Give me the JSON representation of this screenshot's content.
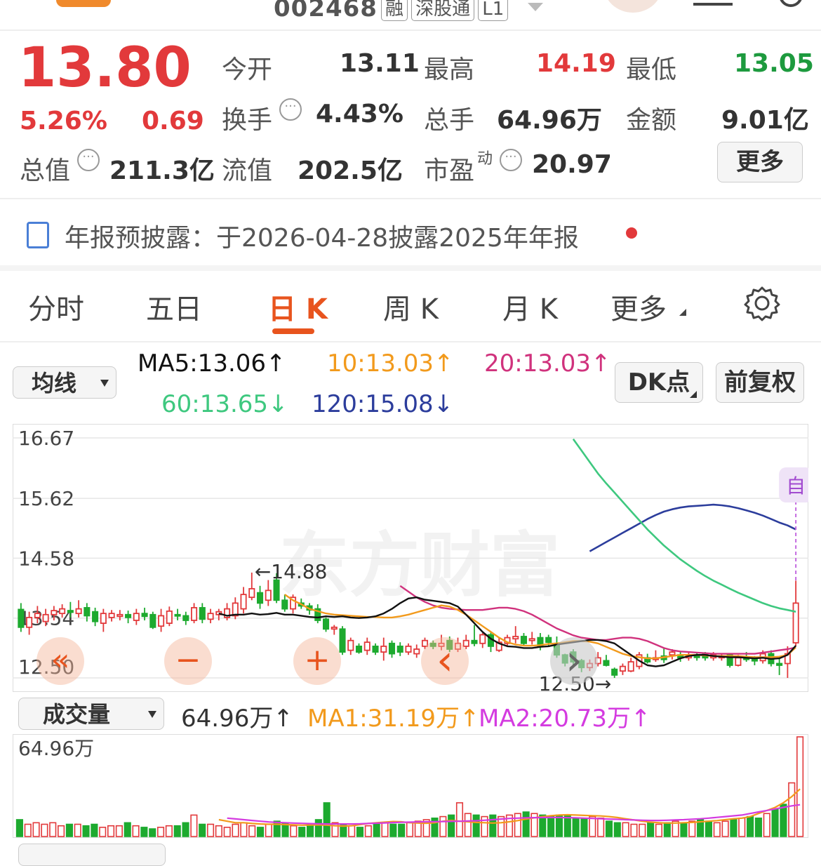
{
  "header": {
    "code": "002468",
    "tags": [
      "融",
      "深股通",
      "L1"
    ]
  },
  "quote": {
    "price": "13.80",
    "change_pct": "5.26%",
    "change_amt": "0.69",
    "items": [
      {
        "label": "今开",
        "value": "13.11"
      },
      {
        "label": "最高",
        "value": "14.19"
      },
      {
        "label": "最低",
        "value": "13.05"
      },
      {
        "label": "换手",
        "value": "4.43%"
      },
      {
        "label": "总手",
        "value": "64.96万"
      },
      {
        "label": "金额",
        "value": "9.01亿"
      },
      {
        "label": "总值",
        "value": "211.3亿"
      },
      {
        "label": "流值",
        "value": "202.5亿"
      },
      {
        "label": "市盈",
        "sup": "动",
        "value": "20.97"
      }
    ],
    "more_label": "更多"
  },
  "notice": {
    "text": "年报预披露：于2026-04-28披露2025年年报"
  },
  "tabs": [
    {
      "label": "分时"
    },
    {
      "label": "五日"
    },
    {
      "label": "日 K",
      "active": true
    },
    {
      "label": "周 K"
    },
    {
      "label": "月 K"
    },
    {
      "label": "更多"
    }
  ],
  "ma_bar": {
    "selector": "均线",
    "ma5": "MA5:13.06",
    "ma10": "10:13.03",
    "ma20": "20:13.03",
    "ma60": "60:13.65",
    "ma120": "120:15.08",
    "dk_label": "DK点",
    "fq_label": "前复权"
  },
  "colors": {
    "up": "#e2393b",
    "down": "#1daa2f",
    "ma5": "#111111",
    "ma10": "#f29a1c",
    "ma20": "#d0327d",
    "ma60": "#3ec87f",
    "ma120": "#2c3d9c",
    "accent": "#e8541e"
  },
  "chart_data": {
    "type": "candlestick",
    "y_ticks": [
      "16.67",
      "15.62",
      "14.58",
      "13.54",
      "12.50"
    ],
    "ylim": [
      12.5,
      16.67
    ],
    "high_annotation": "←14.88",
    "low_annotation": "12.50→",
    "marker_label": "自",
    "watermark": "东方财富",
    "candles": [
      [
        13.69,
        13.38,
        13.8,
        13.3
      ],
      [
        13.38,
        13.55,
        13.65,
        13.25
      ],
      [
        13.55,
        13.62,
        13.75,
        13.45
      ],
      [
        13.48,
        13.6,
        13.7,
        13.4
      ],
      [
        13.6,
        13.67,
        13.75,
        13.5
      ],
      [
        13.62,
        13.7,
        13.78,
        13.55
      ],
      [
        13.67,
        13.64,
        13.82,
        13.55
      ],
      [
        13.62,
        13.7,
        13.85,
        13.55
      ],
      [
        13.72,
        13.58,
        13.8,
        13.48
      ],
      [
        13.65,
        13.48,
        13.72,
        13.4
      ],
      [
        13.45,
        13.62,
        13.7,
        13.3
      ],
      [
        13.55,
        13.62,
        13.68,
        13.48
      ],
      [
        13.57,
        13.6,
        13.68,
        13.5
      ],
      [
        13.6,
        13.55,
        13.67,
        13.45
      ],
      [
        13.5,
        13.62,
        13.7,
        13.42
      ],
      [
        13.62,
        13.57,
        13.72,
        13.5
      ],
      [
        13.6,
        13.38,
        13.65,
        13.35
      ],
      [
        13.4,
        13.58,
        13.7,
        13.3
      ],
      [
        13.45,
        13.66,
        13.74,
        13.4
      ],
      [
        13.6,
        13.58,
        13.7,
        13.5
      ],
      [
        13.58,
        13.5,
        13.65,
        13.42
      ],
      [
        13.5,
        13.72,
        13.8,
        13.45
      ],
      [
        13.72,
        13.52,
        13.8,
        13.45
      ],
      [
        13.52,
        13.62,
        13.7,
        13.45
      ],
      [
        13.6,
        13.65,
        13.7,
        13.5
      ],
      [
        13.55,
        13.7,
        13.8,
        13.5
      ],
      [
        13.58,
        13.8,
        13.9,
        13.52
      ],
      [
        13.7,
        13.95,
        14.08,
        13.62
      ],
      [
        13.9,
        14.05,
        14.33,
        13.85
      ],
      [
        13.98,
        13.8,
        14.1,
        13.7
      ],
      [
        13.85,
        14.02,
        14.2,
        13.75
      ],
      [
        14.2,
        13.85,
        14.32,
        13.8
      ],
      [
        13.85,
        13.7,
        13.95,
        13.65
      ],
      [
        13.7,
        13.9,
        13.95,
        13.62
      ],
      [
        13.8,
        13.75,
        13.88,
        13.7
      ],
      [
        13.75,
        13.68,
        13.8,
        13.6
      ],
      [
        13.7,
        13.5,
        13.78,
        13.45
      ],
      [
        13.52,
        13.35,
        13.55,
        13.3
      ],
      [
        13.35,
        13.38,
        13.42,
        13.25
      ],
      [
        13.35,
        12.95,
        13.4,
        12.9
      ],
      [
        12.98,
        13.15,
        13.2,
        12.9
      ],
      [
        13.05,
        12.95,
        13.1,
        12.92
      ],
      [
        12.98,
        13.12,
        13.2,
        12.9
      ],
      [
        13.05,
        12.95,
        13.1,
        12.9
      ],
      [
        12.95,
        13.05,
        13.2,
        12.8
      ],
      [
        13.1,
        12.92,
        13.15,
        12.85
      ],
      [
        13.05,
        12.95,
        13.12,
        12.88
      ],
      [
        12.95,
        13.05,
        13.1,
        12.9
      ],
      [
        12.92,
        13.0,
        13.08,
        12.85
      ],
      [
        13.05,
        13.15,
        13.2,
        13.0
      ],
      [
        13.1,
        13.05,
        13.15,
        13.0
      ],
      [
        13.05,
        13.1,
        13.25,
        12.98
      ],
      [
        13.15,
        13.0,
        13.22,
        12.95
      ],
      [
        13.0,
        13.1,
        13.2,
        12.95
      ],
      [
        13.05,
        13.15,
        13.25,
        13.0
      ],
      [
        13.15,
        13.1,
        13.42,
        13.05
      ],
      [
        13.1,
        13.25,
        13.28,
        13.02
      ],
      [
        13.25,
        13.05,
        13.3,
        12.95
      ],
      [
        12.98,
        13.12,
        13.2,
        12.95
      ],
      [
        13.1,
        13.2,
        13.25,
        13.05
      ],
      [
        13.18,
        13.22,
        13.4,
        13.1
      ],
      [
        13.22,
        13.1,
        13.28,
        13.05
      ],
      [
        13.15,
        13.18,
        13.3,
        13.08
      ],
      [
        13.2,
        13.05,
        13.28,
        12.98
      ],
      [
        13.2,
        13.12,
        13.25,
        13.05
      ],
      [
        13.1,
        12.9,
        13.22,
        12.85
      ],
      [
        12.9,
        12.76,
        12.92,
        12.7
      ],
      [
        12.95,
        12.78,
        13.0,
        12.7
      ],
      [
        12.8,
        12.68,
        12.83,
        12.6
      ],
      [
        12.68,
        12.75,
        12.82,
        12.62
      ],
      [
        12.75,
        12.85,
        12.95,
        12.7
      ],
      [
        12.8,
        12.72,
        12.9,
        12.7
      ],
      [
        12.65,
        12.55,
        12.68,
        12.5
      ],
      [
        12.62,
        12.7,
        12.75,
        12.55
      ],
      [
        12.62,
        12.78,
        12.85,
        12.6
      ],
      [
        12.7,
        12.9,
        12.95,
        12.65
      ],
      [
        12.85,
        12.78,
        12.92,
        12.75
      ],
      [
        12.82,
        12.85,
        12.98,
        12.78
      ],
      [
        12.88,
        12.82,
        13.02,
        12.76
      ],
      [
        12.9,
        12.95,
        13.0,
        12.82
      ],
      [
        12.9,
        12.85,
        12.95,
        12.78
      ],
      [
        12.85,
        12.9,
        12.95,
        12.8
      ],
      [
        12.88,
        12.86,
        12.93,
        12.8
      ],
      [
        12.92,
        12.85,
        12.95,
        12.8
      ],
      [
        12.85,
        12.9,
        12.95,
        12.8
      ],
      [
        12.85,
        12.88,
        12.92,
        12.8
      ],
      [
        12.9,
        12.72,
        12.93,
        12.68
      ],
      [
        12.72,
        12.85,
        12.9,
        12.7
      ],
      [
        12.85,
        12.82,
        12.95,
        12.78
      ],
      [
        12.82,
        12.8,
        12.88,
        12.72
      ],
      [
        12.8,
        12.92,
        12.98,
        12.75
      ],
      [
        12.92,
        12.75,
        12.98,
        12.7
      ],
      [
        12.75,
        12.72,
        12.85,
        12.55
      ],
      [
        12.75,
        12.92,
        13.05,
        12.5
      ],
      [
        13.11,
        13.8,
        14.19,
        13.05
      ]
    ],
    "ma5": [
      13.62,
      13.58,
      13.6,
      13.6,
      13.62,
      13.6,
      13.61,
      13.63,
      13.6,
      13.6,
      13.58,
      13.56,
      13.55,
      13.57,
      13.56,
      13.57,
      13.55,
      13.54,
      13.55,
      13.57,
      13.62,
      13.7,
      13.8,
      13.88,
      13.9,
      13.86,
      13.84,
      13.82,
      13.8,
      13.74,
      13.6,
      13.45,
      13.3,
      13.18,
      13.1,
      13.05,
      13.04,
      13.02,
      13.02,
      13.04,
      13.05,
      13.08,
      13.1,
      13.12,
      13.14,
      13.16,
      13.16,
      13.14,
      13.1,
      13.0,
      12.9,
      12.8,
      12.72,
      12.7,
      12.72,
      12.78,
      12.84,
      12.88,
      12.9,
      12.9,
      12.88,
      12.87,
      12.86,
      12.86,
      12.85,
      12.84,
      12.85,
      12.83,
      12.84,
      12.9,
      13.06
    ],
    "ma10": [
      13.95,
      13.85,
      13.78,
      13.7,
      13.66,
      13.62,
      13.6,
      13.59,
      13.58,
      13.57,
      13.56,
      13.56,
      13.55,
      13.55,
      13.57,
      13.6,
      13.64,
      13.68,
      13.72,
      13.76,
      13.74,
      13.68,
      13.6,
      13.5,
      13.4,
      13.3,
      13.2,
      13.12,
      13.08,
      13.06,
      13.06,
      13.07,
      13.09,
      13.1,
      13.12,
      13.14,
      13.14,
      13.13,
      13.1,
      13.04,
      12.98,
      12.92,
      12.88,
      12.86,
      12.84,
      12.84,
      12.86,
      12.88,
      12.9,
      12.9,
      12.9,
      12.89,
      12.88,
      12.88,
      12.88,
      12.88,
      12.87,
      12.86,
      12.86,
      12.86,
      12.87,
      12.9,
      13.03
    ],
    "ma20": [
      14.1,
      14.0,
      13.9,
      13.82,
      13.76,
      13.72,
      13.7,
      13.69,
      13.68,
      13.68,
      13.68,
      13.7,
      13.72,
      13.72,
      13.7,
      13.66,
      13.6,
      13.52,
      13.44,
      13.36,
      13.3,
      13.24,
      13.2,
      13.18,
      13.16,
      13.16,
      13.18,
      13.2,
      13.2,
      13.18,
      13.14,
      13.08,
      13.02,
      12.98,
      12.96,
      12.95,
      12.94,
      12.93,
      12.92,
      12.92,
      12.92,
      12.92,
      12.92,
      12.92,
      12.94,
      12.96,
      12.98,
      13.0,
      13.03
    ],
    "ma60": [
      16.65,
      16.45,
      16.25,
      16.05,
      15.88,
      15.72,
      15.56,
      15.4,
      15.24,
      15.08,
      14.94,
      14.8,
      14.68,
      14.56,
      14.46,
      14.36,
      14.27,
      14.19,
      14.12,
      14.05,
      13.98,
      13.92,
      13.86,
      13.8,
      13.75,
      13.71,
      13.68,
      13.65
    ],
    "ma120": [
      14.7,
      14.78,
      14.86,
      14.94,
      15.02,
      15.1,
      15.18,
      15.26,
      15.33,
      15.39,
      15.43,
      15.46,
      15.48,
      15.49,
      15.5,
      15.51,
      15.5,
      15.48,
      15.45,
      15.41,
      15.37,
      15.32,
      15.26,
      15.2,
      15.15,
      15.08
    ]
  },
  "volume": {
    "selector": "成交量",
    "value": "64.96万",
    "ma1": "MA1:31.19万",
    "ma2": "MA2:20.73万",
    "max_label": "64.96万",
    "values": [
      11,
      8,
      9,
      8,
      9,
      7,
      8,
      8,
      7,
      8,
      6,
      7,
      7,
      9,
      7,
      6,
      5,
      6,
      7,
      7,
      9,
      14,
      8,
      8,
      7,
      6,
      8,
      9,
      7,
      6,
      8,
      10,
      9,
      7,
      6,
      8,
      11,
      22,
      9,
      8,
      7,
      6,
      7,
      8,
      9,
      8,
      8,
      9,
      10,
      11,
      12,
      13,
      14,
      22,
      15,
      14,
      13,
      14,
      13,
      14,
      15,
      16,
      15,
      14,
      13,
      14,
      14,
      12,
      12,
      13,
      12,
      10,
      9,
      9,
      8,
      8,
      9,
      8,
      9,
      10,
      9,
      10,
      11,
      10,
      9,
      10,
      11,
      12,
      13,
      12,
      15,
      18,
      21,
      35,
      65
    ],
    "ma1_line": [
      11,
      10,
      9,
      9,
      8.5,
      8.2,
      8,
      8,
      7.8,
      7.6,
      7.4,
      7.5,
      7.6,
      7.4,
      7,
      6.8,
      7,
      7.8,
      8.5,
      9,
      9.4,
      9.8,
      9.6,
      9,
      8.8,
      8.6,
      9,
      10,
      10.5,
      10,
      9.6,
      9.2,
      9,
      8.8,
      9,
      9.6,
      10.4,
      11.4,
      12.2,
      13,
      13.6,
      14,
      14.2,
      14,
      13.8,
      13.6,
      13.4,
      13,
      12.4,
      11.6,
      10.8,
      10,
      9.4,
      9,
      8.8,
      8.8,
      9,
      9.2,
      9.6,
      10,
      10.4,
      11,
      11.6,
      12,
      13,
      15,
      17,
      19,
      22,
      26,
      31
    ],
    "ma2_line": [
      12,
      11.5,
      11,
      10.5,
      10,
      9.5,
      9.2,
      9,
      8.8,
      8.6,
      8.4,
      8.3,
      8.2,
      8.2,
      8.2,
      8.2,
      8.3,
      8.5,
      8.7,
      8.9,
      9.1,
      9.3,
      9.4,
      9.5,
      9.6,
      9.7,
      9.8,
      9.9,
      10,
      10.1,
      10.3,
      10.6,
      11,
      11.4,
      11.8,
      12,
      12.2,
      12.3,
      12.4,
      12.4,
      12.4,
      12.3,
      12.2,
      12,
      11.8,
      11.6,
      11.4,
      11.2,
      11,
      10.8,
      10.6,
      10.5,
      10.5,
      10.6,
      10.8,
      11,
      11.3,
      11.6,
      12,
      12.5,
      13,
      13.5,
      14,
      15,
      16,
      17,
      18,
      19,
      20,
      20.73
    ]
  },
  "controls": {
    "first": "«",
    "zoom_out": "−",
    "zoom_in": "+",
    "prev": "‹",
    "next": "›"
  }
}
